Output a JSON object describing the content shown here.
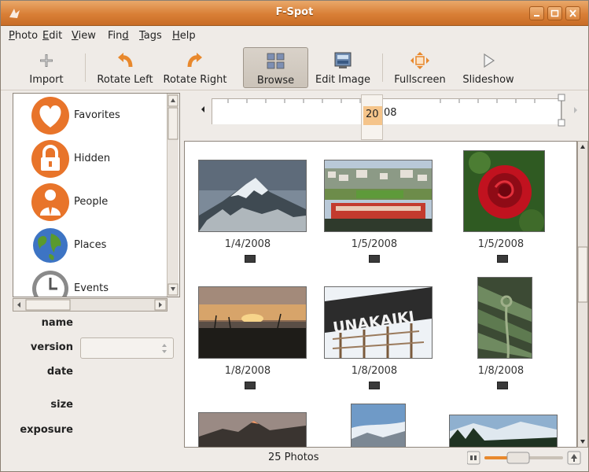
{
  "window": {
    "title": "F-Spot"
  },
  "menu": [
    {
      "label": "Photo",
      "u": "P",
      "rest": "hoto"
    },
    {
      "label": "Edit",
      "u": "E",
      "rest": "dit"
    },
    {
      "label": "View",
      "u": "V",
      "rest": "iew"
    },
    {
      "label": "Find",
      "pre": "Fin",
      "u": "d"
    },
    {
      "label": "Tags",
      "u": "T",
      "rest": "ags"
    },
    {
      "label": "Help",
      "u": "H",
      "rest": "elp"
    }
  ],
  "toolbar": {
    "import": "Import",
    "rotate_left": "Rotate Left",
    "rotate_right": "Rotate Right",
    "browse": "Browse",
    "edit_image": "Edit Image",
    "fullscreen": "Fullscreen",
    "slideshow": "Slideshow"
  },
  "tags": [
    "Favorites",
    "Hidden",
    "People",
    "Places",
    "Events"
  ],
  "info": {
    "name": "name",
    "version": "version",
    "date": "date",
    "size": "size",
    "exposure": "exposure"
  },
  "timeline": {
    "year_a": "20",
    "year_b": "08"
  },
  "photos": [
    {
      "date": "1/4/2008"
    },
    {
      "date": "1/5/2008"
    },
    {
      "date": "1/5/2008"
    },
    {
      "date": "1/8/2008"
    },
    {
      "date": "1/8/2008"
    },
    {
      "date": "1/8/2008"
    }
  ],
  "status": {
    "count": "25 Photos"
  },
  "zoom": {
    "level": 0.4
  },
  "colors": {
    "accent": "#d97f36",
    "tag_orange": "#e8742a"
  }
}
